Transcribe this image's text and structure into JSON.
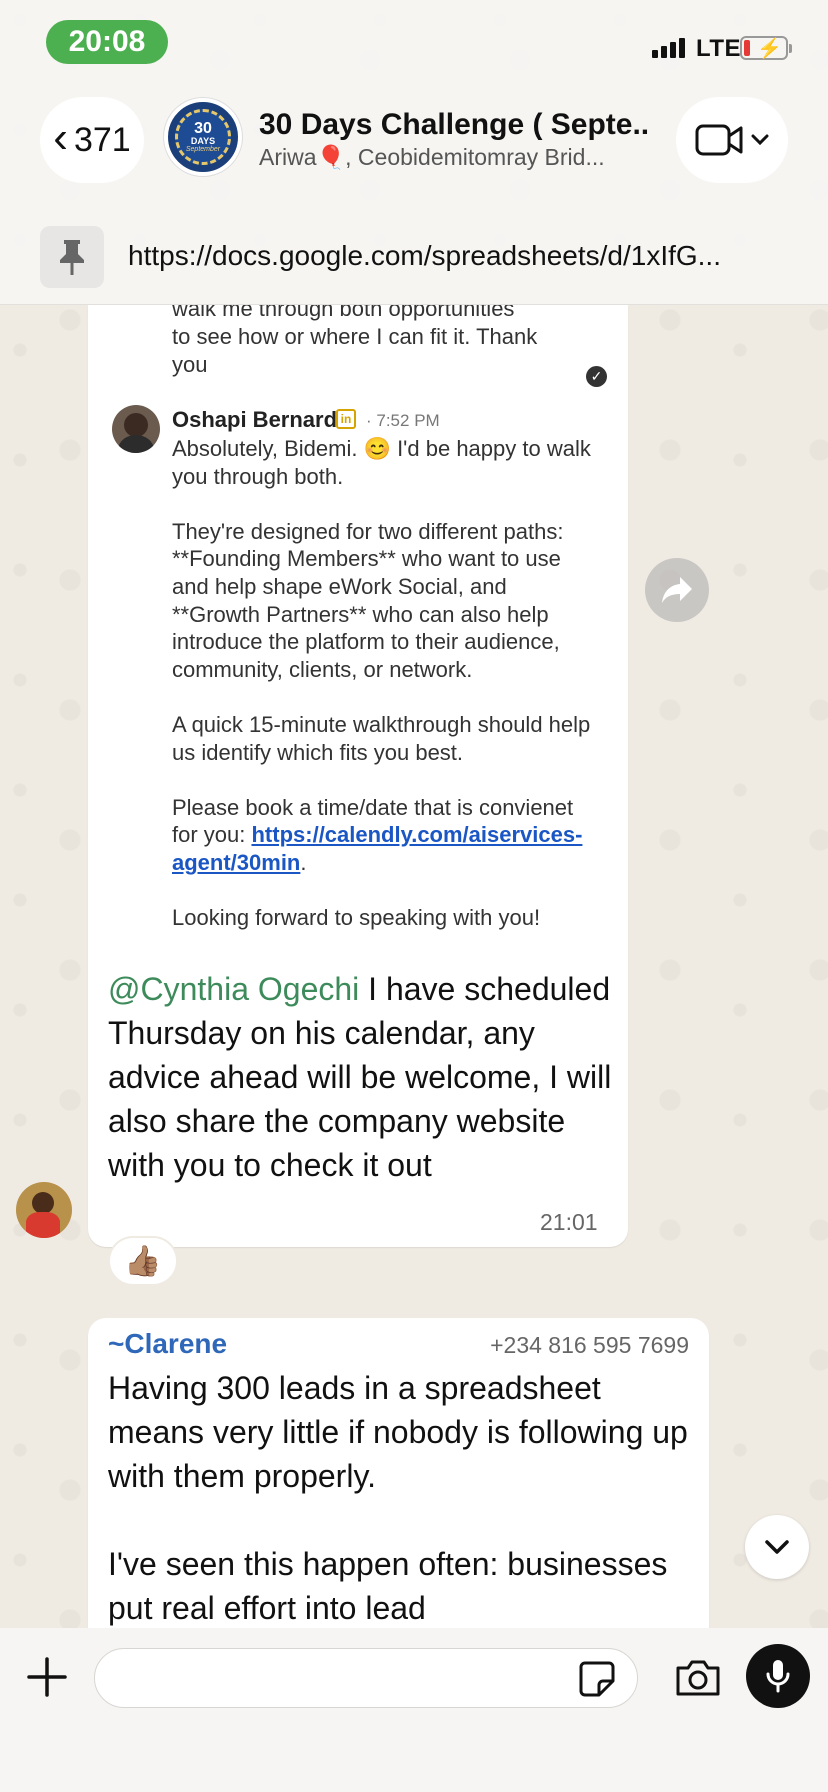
{
  "status_bar": {
    "time": "20:08",
    "network": "LTE"
  },
  "header": {
    "back_count": "371",
    "group_avatar": {
      "line1": "30",
      "line2": "DAYS",
      "line3": "September"
    },
    "title": "30 Days Challenge ( Septe...",
    "subtitle": "Ariwa🎈, Ceobidemitomray Brid...",
    "video_icon": "video-camera-icon"
  },
  "pinned": {
    "icon": "pin-icon",
    "text": "https://docs.google.com/spreadsheets/d/1xIfG..."
  },
  "messages": [
    {
      "screenshot": {
        "prev_text": "walk me through both opportunities\nto see how or where I can fit it. Thank you",
        "name": "Oshapi Bernard",
        "badge": "in",
        "time": "· 7:52 PM",
        "body_1": "Absolutely, Bidemi. 😊 I'd be happy to walk you through both.\n\nThey're designed for two different paths: **Founding Members** who want to use and help shape eWork Social, and **Growth Partners** who can also help introduce the platform to their audience, community, clients, or network.\n\nA quick 15-minute walkthrough should help us identify which fits you best.\n\nPlease book a time/date that is convienet for you: ",
        "link": "https://calendly.com/aiservices-agent/30min",
        "body_2": ".\n\nLooking forward to speaking with you!"
      },
      "mention": "@Cynthia Ogechi",
      "text": " I have scheduled Thursday on his calendar, any advice ahead will be welcome, I will also share the company website with you to check it out",
      "time": "21:01",
      "reaction": "👍🏽"
    },
    {
      "sender": "~Clarene",
      "phone": "+234 816 595 7699",
      "text": "Having 300 leads in a spreadsheet means very little if nobody is following up with them properly.\n\nI've seen this happen often: businesses put real effort into lead"
    }
  ],
  "composer": {
    "placeholder": "",
    "value": ""
  },
  "colors": {
    "mention": "#3d8b5a",
    "sender_name": "#2f67b9",
    "status_green": "#4caf50",
    "chat_background": "#efeae2"
  }
}
